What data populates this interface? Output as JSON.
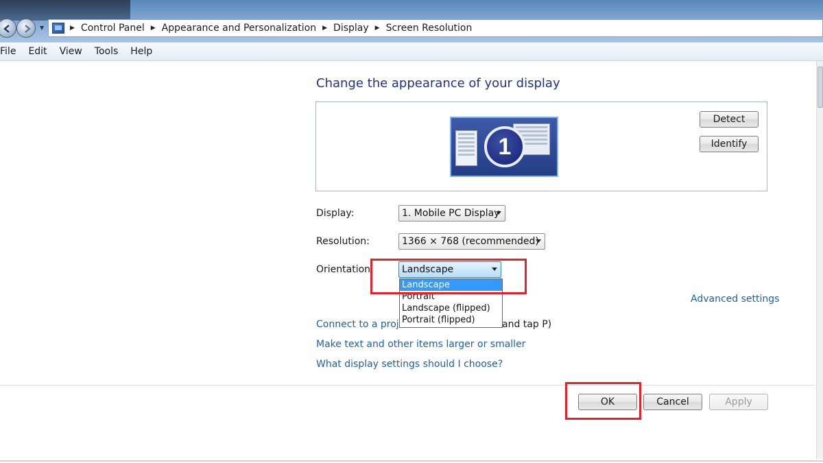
{
  "address_bar": {
    "breadcrumbs": [
      "Control Panel",
      "Appearance and Personalization",
      "Display",
      "Screen Resolution"
    ]
  },
  "menu": [
    "File",
    "Edit",
    "View",
    "Tools",
    "Help"
  ],
  "main": {
    "heading": "Change the appearance of your display",
    "monitor_number": "1",
    "detect_label": "Detect",
    "identify_label": "Identify",
    "display": {
      "label": "Display:",
      "value": "1. Mobile PC Display"
    },
    "resolution": {
      "label": "Resolution:",
      "value": "1366 × 768 (recommended)"
    },
    "orientation": {
      "label": "Orientation:",
      "value": "Landscape",
      "options": [
        "Landscape",
        "Portrait",
        "Landscape (flipped)",
        "Portrait (flipped)"
      ],
      "selected_index": 0
    },
    "advanced_link": "Advanced settings",
    "link_projector_start": "Connect to a projec",
    "link_projector_end": "and tap P)",
    "link_text_size": "Make text and other items larger or smaller",
    "link_settings_help": "What display settings should I choose?"
  },
  "footer": {
    "ok_label": "OK",
    "cancel_label": "Cancel",
    "apply_label": "Apply"
  },
  "colors": {
    "link": "#1e5fa8",
    "heading": "#1e3287",
    "highlight": "#e8202a",
    "selection": "#3399ff"
  }
}
